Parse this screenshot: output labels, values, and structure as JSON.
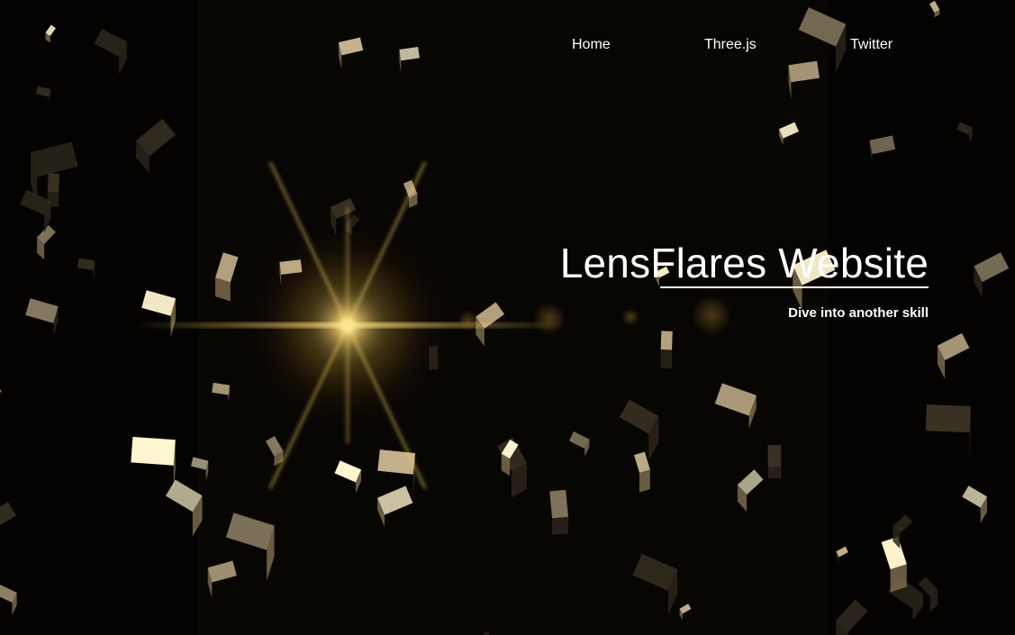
{
  "page": {
    "title": "LensFlares Website"
  },
  "nav": {
    "items": [
      {
        "label": "Home"
      },
      {
        "label": "Three.js"
      },
      {
        "label": "Twitter"
      }
    ]
  },
  "hero": {
    "title": "LensFlares Website",
    "subtitle": "Dive into another skill"
  },
  "scene": {
    "background_color": "#040302",
    "cube_light_color": "#fff6cf",
    "cube_mid_color": "#c9b58f",
    "cube_dark_color": "#3a3224",
    "flare_color": "#ffcf4a",
    "cube_count": 64
  }
}
